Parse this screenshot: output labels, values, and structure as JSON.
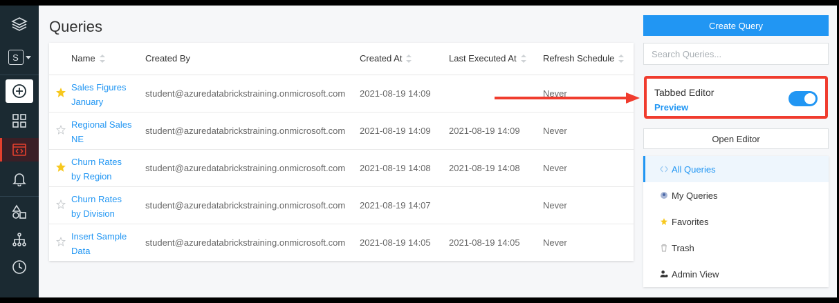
{
  "page": {
    "title": "Queries"
  },
  "table": {
    "headers": {
      "name": "Name",
      "created_by": "Created By",
      "created_at": "Created At",
      "last_executed_at": "Last Executed At",
      "refresh_schedule": "Refresh Schedule"
    },
    "rows": [
      {
        "favorite": true,
        "name_line1": "Sales Figures",
        "name_line2": "January",
        "created_by": "student@azuredatabrickstraining.onmicrosoft.com",
        "created_at": "2021-08-19 14:09",
        "last_executed_at": "",
        "refresh_schedule": "Never"
      },
      {
        "favorite": false,
        "name_line1": "Regional Sales",
        "name_line2": "NE",
        "created_by": "student@azuredatabrickstraining.onmicrosoft.com",
        "created_at": "2021-08-19 14:09",
        "last_executed_at": "2021-08-19 14:09",
        "refresh_schedule": "Never"
      },
      {
        "favorite": true,
        "name_line1": "Churn Rates",
        "name_line2": "by Region",
        "created_by": "student@azuredatabrickstraining.onmicrosoft.com",
        "created_at": "2021-08-19 14:08",
        "last_executed_at": "2021-08-19 14:08",
        "refresh_schedule": "Never"
      },
      {
        "favorite": false,
        "name_line1": "Churn Rates",
        "name_line2": "by Division",
        "created_by": "student@azuredatabrickstraining.onmicrosoft.com",
        "created_at": "2021-08-19 14:07",
        "last_executed_at": "",
        "refresh_schedule": "Never"
      },
      {
        "favorite": false,
        "name_line1": "Insert Sample",
        "name_line2": "Data",
        "created_by": "student@azuredatabrickstraining.onmicrosoft.com",
        "created_at": "2021-08-19 14:05",
        "last_executed_at": "2021-08-19 14:05",
        "refresh_schedule": "Never"
      }
    ]
  },
  "sidebar": {
    "workspace_letter": "S",
    "icons": [
      "layers-icon",
      "workspace-switcher",
      "create-icon",
      "dashboards-icon",
      "queries-icon",
      "alerts-icon",
      "data-icon",
      "history-icon",
      "clock-icon"
    ]
  },
  "right_panel": {
    "create_label": "Create Query",
    "search_placeholder": "Search Queries...",
    "tabbed_editor_title": "Tabbed Editor",
    "tabbed_editor_preview": "Preview",
    "tabbed_editor_enabled": true,
    "open_editor_label": "Open Editor",
    "menu": [
      {
        "label": "All Queries",
        "icon": "code-icon",
        "active": true
      },
      {
        "label": "My Queries",
        "icon": "user-icon",
        "active": false
      },
      {
        "label": "Favorites",
        "icon": "star-icon",
        "active": false
      },
      {
        "label": "Trash",
        "icon": "trash-icon",
        "active": false
      },
      {
        "label": "Admin View",
        "icon": "admin-icon",
        "active": false
      }
    ]
  },
  "colors": {
    "accent": "#2196f3",
    "highlight_box": "#f03c2e",
    "star_filled": "#f7c81e",
    "sidebar_bg": "#1b2a32"
  }
}
